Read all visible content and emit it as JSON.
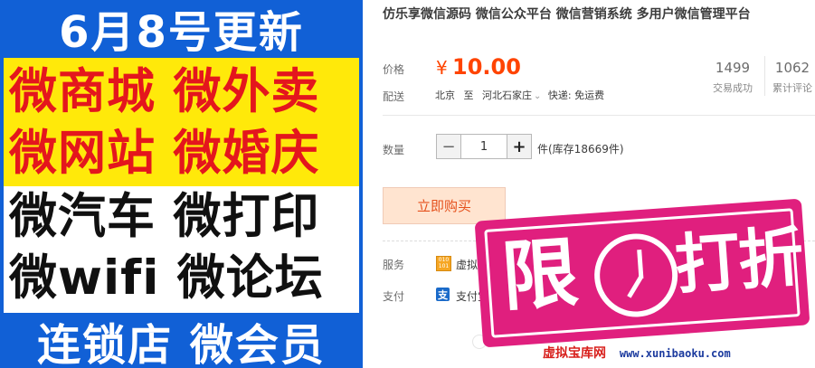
{
  "banner": {
    "title": "6月8号更新",
    "line1": "微商城 微外卖",
    "line2": "微网站 微婚庆",
    "line3": "微汽车 微打印",
    "line4": "微wifi 微论坛",
    "bottom": "连锁店 微会员"
  },
  "product": {
    "title": "仿乐享微信源码 微信公众平台 微信营销系统 多用户微信管理平台",
    "price_label": "价格",
    "price_symbol": "¥",
    "price": "10.00",
    "sales_count": "1499",
    "sales_label": "交易成功",
    "review_count": "1062",
    "review_label": "累计评论",
    "delivery_label": "配送",
    "delivery_from": "北京",
    "delivery_to_word": "至",
    "delivery_to": "河北石家庄",
    "delivery_info": "快递: 免运费",
    "quantity_label": "数量",
    "quantity_value": "1",
    "minus": "−",
    "plus": "+",
    "stock_text": "件(库存18669件)",
    "buy_button": "立即购买",
    "service_label": "服务",
    "service_text": "虚拟物",
    "payment_label": "支付",
    "payment_text": "支付宝"
  },
  "promo": {
    "char1": "限",
    "char2": "打折"
  },
  "watermark": {
    "site": "虚拟宝库网",
    "url": "www.xunibaoku.com"
  },
  "colors": {
    "price": "#ff4400",
    "banner_blue": "#1160d6",
    "banner_yellow": "#ffe90a",
    "promo_pink": "#e01f7e"
  }
}
